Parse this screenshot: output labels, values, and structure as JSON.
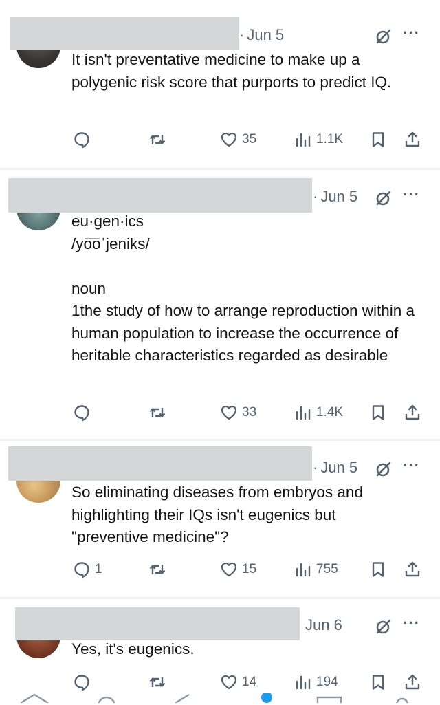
{
  "posts": [
    {
      "date": "Jun 5",
      "text": "It isn't preventative medicine to make up a polygenic risk score that purports to predict IQ.",
      "replies": "",
      "reposts": "",
      "likes": "35",
      "views": "1.1K"
    },
    {
      "date": "Jun 5",
      "text": "eu·gen·ics\n/yo͞oˈjeniks/\n\nnoun\n1the study of how to arrange reproduction within a human population to increase the occurrence of heritable characteristics regarded as desirable",
      "replies": "",
      "reposts": "",
      "likes": "33",
      "views": "1.4K"
    },
    {
      "date": "Jun 5",
      "text": "So eliminating diseases from embryos and highlighting their IQs isn't eugenics but \"preventive medicine\"?",
      "replies": "1",
      "reposts": "",
      "likes": "15",
      "views": "755"
    },
    {
      "date": "Jun 6",
      "text": "Yes, it's eugenics.",
      "replies": "",
      "reposts": "",
      "likes": "14",
      "views": "194"
    }
  ],
  "icons": {
    "reply": "reply-icon",
    "repost": "repost-icon",
    "like": "like-icon",
    "views": "views-icon",
    "bookmark": "bookmark-icon",
    "share": "share-icon",
    "grok": "grok-icon",
    "more": "more-icon"
  },
  "colors": {
    "muted": "#536471",
    "text": "#141414",
    "redaction": "#d5d6d7",
    "divider": "#eef0f2"
  }
}
